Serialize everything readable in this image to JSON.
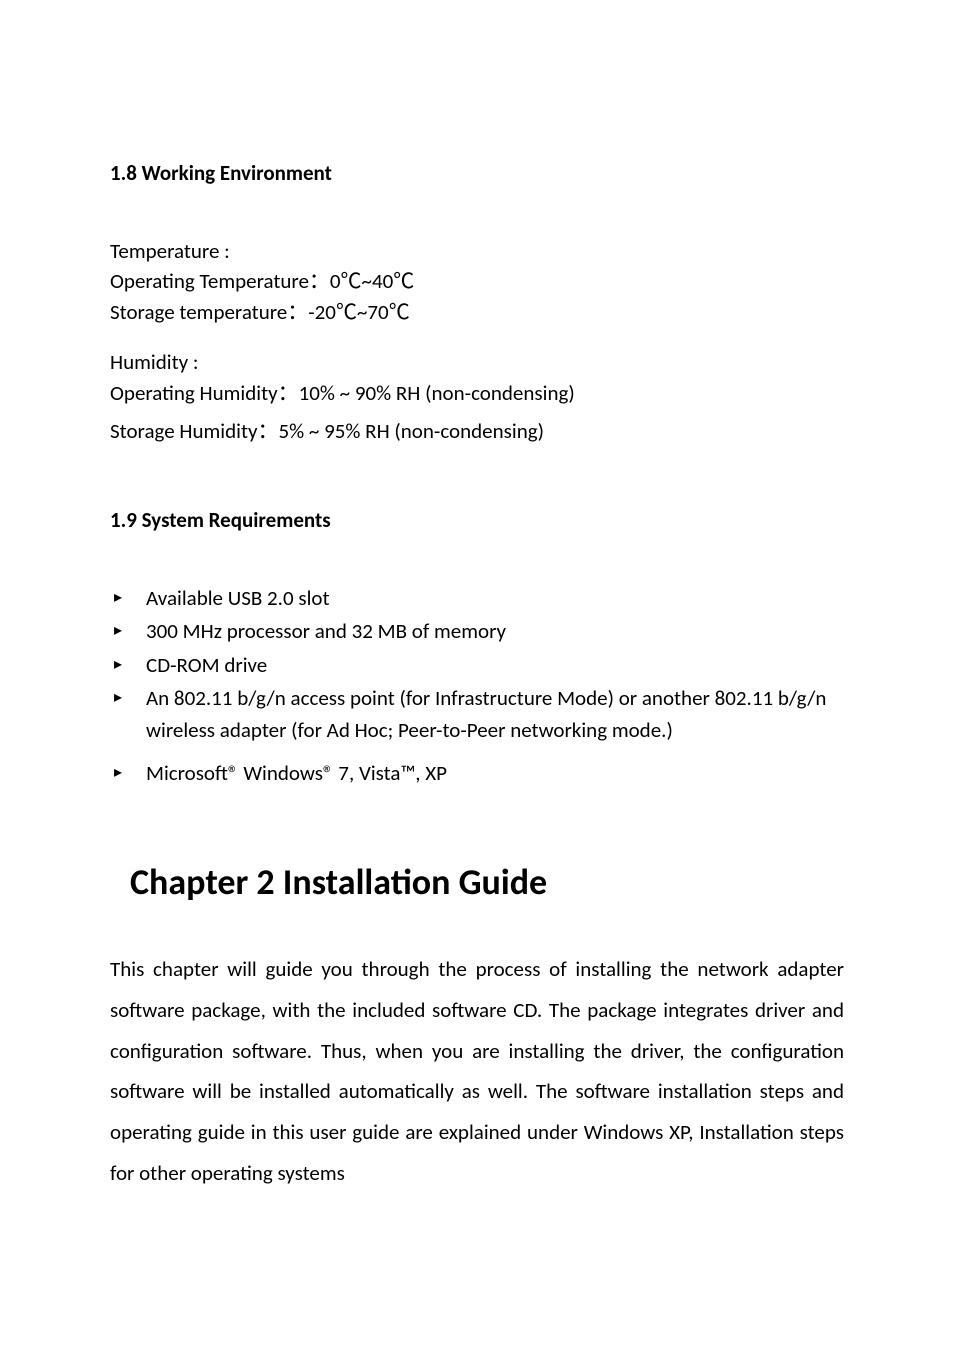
{
  "sections": {
    "workingEnv": {
      "heading": "1.8 Working Environment",
      "temperature": {
        "label": "Temperature :",
        "operating": "Operating Temperature：0℃~40℃",
        "storage": "Storage temperature：-20℃~70℃"
      },
      "humidity": {
        "label": "Humidity :",
        "operating": "Operating Humidity：10% ~ 90% RH (non-condensing)",
        "storage": "Storage Humidity：5% ~ 95% RH (non-condensing)"
      }
    },
    "sysReq": {
      "heading": "1.9 System Requirements",
      "items": [
        "Available USB 2.0 slot",
        "300 MHz processor and 32 MB of memory",
        "CD-ROM drive",
        "An 802.11 b/g/n access point (for Infrastructure Mode) or another 802.11 b/g/n wireless adapter (for Ad Hoc; Peer-to-Peer networking mode.)",
        "Microsoft® Windows® 7, Vista™, XP"
      ]
    },
    "chapter2": {
      "title": "Chapter 2 Installation Guide",
      "paragraph": "This chapter will guide you through the process of installing the network adapter software package, with the included software CD. The package integrates driver and configuration software. Thus, when you are installing the driver, the configuration software will be installed automatically as well. The software installation steps and operating guide in this user guide are explained under Windows XP, Installation steps for other operating systems"
    }
  }
}
